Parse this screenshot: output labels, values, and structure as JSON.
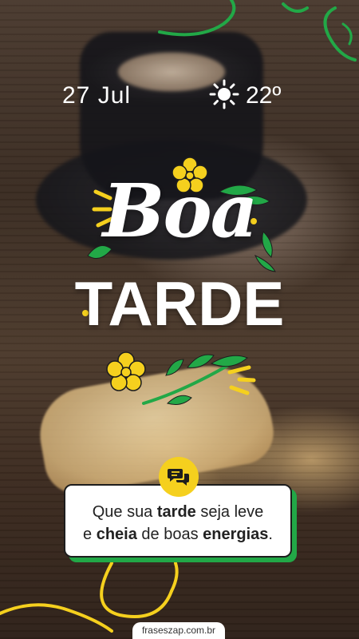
{
  "header": {
    "date": "27 Jul",
    "temperature": "22º",
    "weather_icon": "sun-icon"
  },
  "title": {
    "line1": "Boa",
    "line2": "TARDE"
  },
  "message": {
    "icon": "chat-bubbles-icon",
    "line1_prefix": "Que sua ",
    "line1_bold": "tarde",
    "line1_suffix": " seja leve",
    "line2_prefix": "e ",
    "line2_bold1": "cheia",
    "line2_mid": " de boas ",
    "line2_bold2": "energias",
    "line2_suffix": "."
  },
  "footer": {
    "site": "fraseszap.com.br"
  },
  "colors": {
    "yellow": "#f5d01e",
    "green": "#22a847",
    "white": "#ffffff"
  }
}
